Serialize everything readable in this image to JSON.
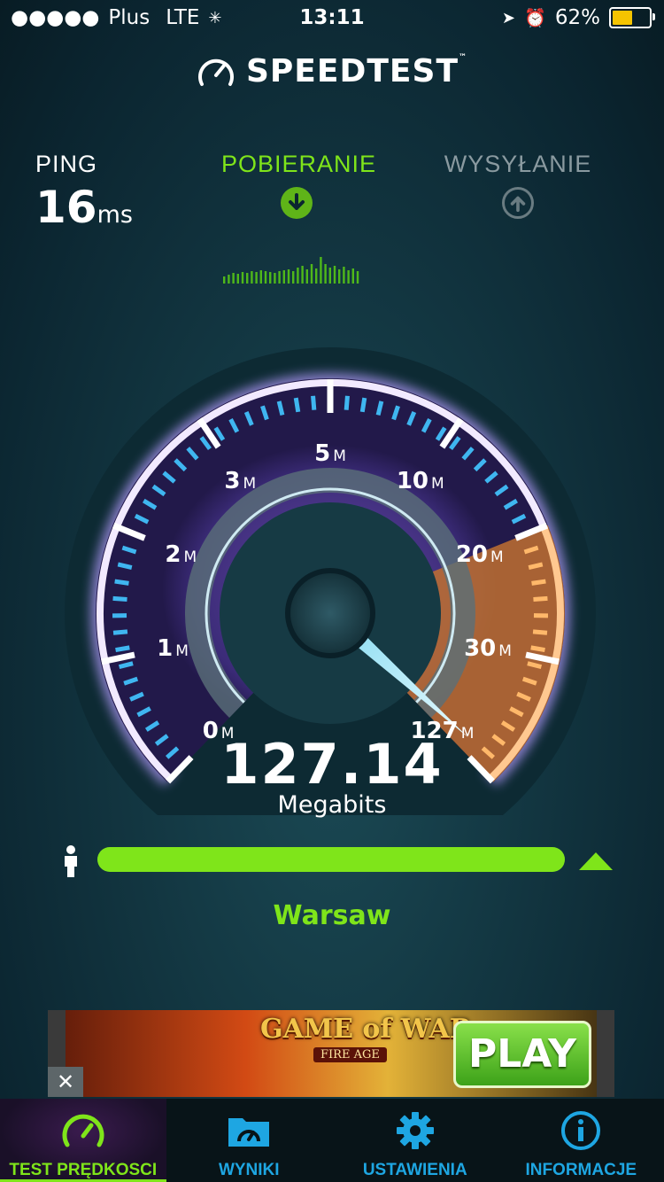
{
  "status_bar": {
    "carrier": "Plus",
    "network": "LTE",
    "time": "13:11",
    "battery_percent": "62%",
    "battery_level": 0.62
  },
  "app": {
    "logo_text": "SPEEDTEST",
    "trademark": "™"
  },
  "metrics": {
    "ping": {
      "label": "PING",
      "value": "16",
      "unit": "ms"
    },
    "download": {
      "label": "POBIERANIE"
    },
    "upload": {
      "label": "WYSYŁANIE"
    }
  },
  "gauge": {
    "ticks": [
      {
        "num": "0",
        "unit": "M"
      },
      {
        "num": "1",
        "unit": "M"
      },
      {
        "num": "2",
        "unit": "M"
      },
      {
        "num": "3",
        "unit": "M"
      },
      {
        "num": "5",
        "unit": "M"
      },
      {
        "num": "10",
        "unit": "M"
      },
      {
        "num": "20",
        "unit": "M"
      },
      {
        "num": "30",
        "unit": "M"
      },
      {
        "num": "127",
        "unit": "M"
      }
    ],
    "reading": "127.14",
    "unit": "Megabits"
  },
  "progress": {
    "fraction": 1.0
  },
  "server": {
    "location": "Warsaw"
  },
  "ad": {
    "title": "GAME of WAR",
    "subtitle": "FIRE AGE",
    "cta": "PLAY",
    "close": "✕"
  },
  "tabs": [
    {
      "label": "TEST PRĘDKOSCI",
      "icon": "speedometer-icon",
      "active": true
    },
    {
      "label": "WYNIKI",
      "icon": "folder-gauge-icon",
      "active": false
    },
    {
      "label": "USTAWIENIA",
      "icon": "gear-icon",
      "active": false
    },
    {
      "label": "INFORMACJE",
      "icon": "info-icon",
      "active": false
    }
  ],
  "colors": {
    "accent": "#7fe51a",
    "tab_blue": "#1ea6e2",
    "gauge_orange": "#f08a2a"
  }
}
